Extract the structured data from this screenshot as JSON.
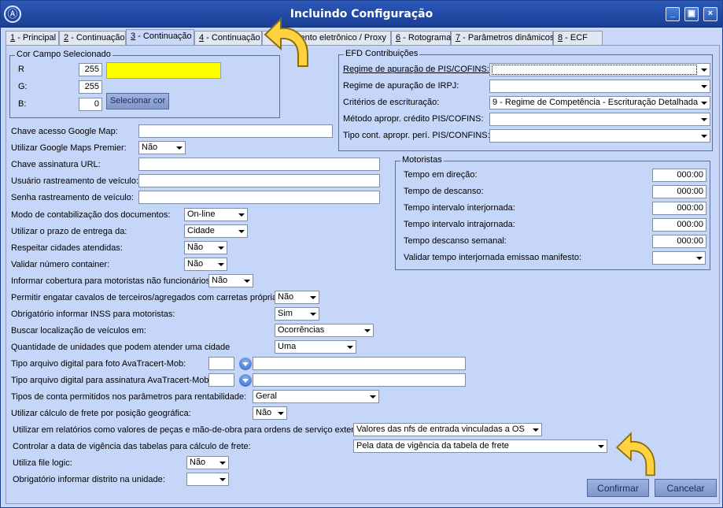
{
  "window": {
    "title": "Incluindo Configuração",
    "app_icon": "logo-icon",
    "controls": [
      "minimize-icon",
      "restore-icon",
      "close-icon"
    ]
  },
  "tabs": [
    {
      "key": "1",
      "label": " - Principal"
    },
    {
      "key": "2",
      "label": " - Continuação"
    },
    {
      "key": "3",
      "label": " - Continuação"
    },
    {
      "key": "4",
      "label": " - Continuação"
    },
    {
      "key": "5",
      "label": "ento eletrônico / Proxy"
    },
    {
      "key": "6",
      "label": " - Rotograma"
    },
    {
      "key": "7",
      "label": " - Parâmetros dinâmicos"
    },
    {
      "key": "8",
      "label": " - ECF"
    }
  ],
  "active_tab": 3,
  "color_group": {
    "title": "Cor Campo Selecionado",
    "r_label": "R",
    "r_value": "255",
    "g_label": "G:",
    "g_value": "255",
    "b_label": "B:",
    "b_value": "0",
    "swatch_color": "#ffff00",
    "select_button": "Selecionar cor"
  },
  "efd": {
    "title": "EFD Contribuições",
    "fields": [
      {
        "label": "Regime de apuração de PIS/COFINS:",
        "value": ""
      },
      {
        "label": "Regime de apuração de IRPJ:",
        "value": ""
      },
      {
        "label": "Critérios de escrituração:",
        "value": "9 - Regime de Competência - Escrituração Detalhada"
      },
      {
        "label": "Método apropr. crédito PIS/COFINS:",
        "value": ""
      },
      {
        "label": "Tipo cont. apropr. perí. PIS/CONFINS:",
        "value": ""
      }
    ]
  },
  "motoristas": {
    "title": "Motoristas",
    "fields": [
      {
        "label": "Tempo em direção:",
        "value": "000:00"
      },
      {
        "label": "Tempo de descanso:",
        "value": "000:00"
      },
      {
        "label": "Tempo intervalo interjornada:",
        "value": "000:00"
      },
      {
        "label": "Tempo intervalo intrajornada:",
        "value": "000:00"
      },
      {
        "label": "Tempo descanso semanal:",
        "value": "000:00"
      },
      {
        "label": "Validar tempo interjornada emissao manifesto:",
        "value": ""
      }
    ]
  },
  "form": {
    "google_key_label": "Chave acesso Google Map:",
    "google_key_value": "",
    "google_premier_label": "Utilizar Google Maps Premier:",
    "google_premier_value": "Não",
    "url_key_label": "Chave assinatura URL:",
    "url_key_value": "",
    "track_user_label": "Usuário rastreamento de veículo:",
    "track_user_value": "",
    "track_pass_label": "Senha rastreamento de veículo:",
    "track_pass_value": "",
    "contab_label": "Modo de contabilização dos documentos:",
    "contab_value": "On-line",
    "prazo_label": "Utilizar o prazo de entrega da:",
    "prazo_value": "Cidade",
    "cidades_label": "Respeitar cidades atendidas:",
    "cidades_value": "Não",
    "container_label": "Validar número container:",
    "container_value": "Não",
    "cobertura_label": "Informar cobertura para motoristas não funcionários:",
    "cobertura_value": "Não",
    "engatar_label": "Permitir engatar cavalos de terceiros/agregados com carretas próprias:",
    "engatar_value": "Não",
    "inss_label": "Obrigatório informar INSS para motoristas:",
    "inss_value": "Sim",
    "localizacao_label": "Buscar localização de veículos em:",
    "localizacao_value": "Ocorrências",
    "unidades_label": "Quantidade de unidades que podem atender uma cidade",
    "unidades_value": "Uma",
    "foto_label": "Tipo arquivo digital para foto AvaTracert-Mob:",
    "foto_code": "",
    "foto_desc": "",
    "assinatura_label": "Tipo arquivo digital para assinatura AvaTracert-Mob:",
    "assinatura_code": "",
    "assinatura_desc": "",
    "conta_label": "Tipos de conta permitidos nos parâmetros para rentabilidade:",
    "conta_value": "Geral",
    "frete_geo_label": "Utilizar cálculo de frete por posição geográfica:",
    "frete_geo_value": "Não",
    "relatorios_label": "Utilizar em relatórios como valores de peças e mão-de-obra para ordens de serviço externa:",
    "relatorios_value": "Valores das nfs de entrada vinculadas a OS",
    "vigencia_label": "Controlar a data de vigência das tabelas para cálculo de frete:",
    "vigencia_value": "Pela data de vigência da tabela de frete",
    "filelogic_label": "Utiliza file logic:",
    "filelogic_value": "Não",
    "distrito_label": "Obrigatório informar distrito na unidade:",
    "distrito_value": ""
  },
  "buttons": {
    "confirm": "Confirmar",
    "cancel": "Cancelar"
  },
  "annotations": [
    "curved-arrow-icon",
    "curved-arrow-icon"
  ],
  "colors": {
    "title_bar": "#1f4aa6",
    "panel": "#c6d6f8",
    "highlight_arrow": "#ffd23f"
  }
}
